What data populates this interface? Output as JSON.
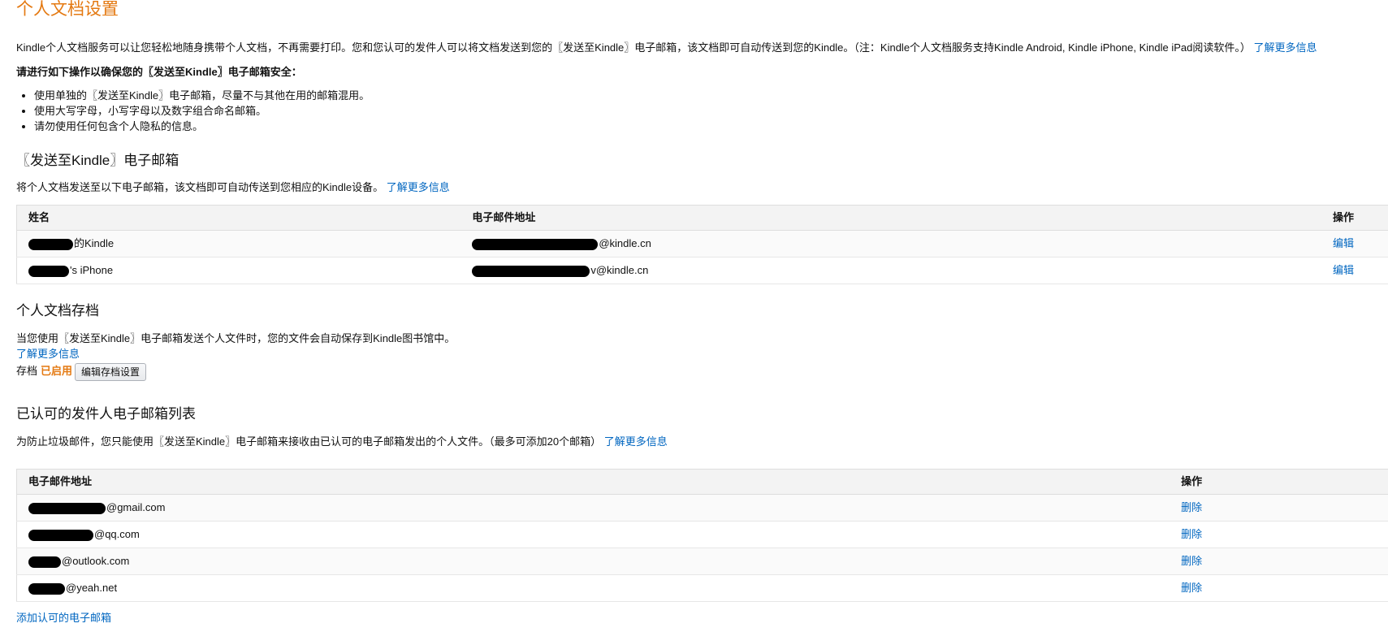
{
  "page": {
    "title": "个人文档设置",
    "intro_text": "Kindle个人文档服务可以让您轻松地随身携带个人文档，不再需要打印。您和您认可的发件人可以将文档发送到您的〖发送至Kindle〗电子邮箱，该文档即可自动传送到您的Kindle。（注：Kindle个人文档服务支持Kindle Android, Kindle iPhone, Kindle iPad阅读软件。）",
    "learn_more": "了解更多信息",
    "security_heading": "请进行如下操作以确保您的〖发送至Kindle〗电子邮箱安全：",
    "tips": [
      "使用单独的〖发送至Kindle〗电子邮箱，尽量不与其他在用的邮箱混用。",
      "使用大写字母，小写字母以及数字组合命名邮箱。",
      "请勿使用任何包含个人隐私的信息。"
    ]
  },
  "send_to_kindle": {
    "title": "〖发送至Kindle〗电子邮箱",
    "desc": "将个人文档发送至以下电子邮箱，该文档即可自动传送到您相应的Kindle设备。",
    "learn_more": "了解更多信息",
    "columns": {
      "name": "姓名",
      "email": "电子邮件地址",
      "action": "操作"
    },
    "rows": [
      {
        "name_suffix": "的Kindle",
        "email_suffix": "@kindle.cn",
        "action": "编辑"
      },
      {
        "name_suffix": "'s iPhone",
        "email_suffix": "v@kindle.cn",
        "action": "编辑"
      }
    ]
  },
  "archive": {
    "title": "个人文档存档",
    "desc": "当您使用〖发送至Kindle〗电子邮箱发送个人文件时，您的文件会自动保存到Kindle图书馆中。",
    "learn_more": "了解更多信息",
    "label": "存档",
    "status": "已启用",
    "edit_button": "编辑存档设置"
  },
  "approved_senders": {
    "title": "已认可的发件人电子邮箱列表",
    "desc": "为防止垃圾邮件，您只能使用〖发送至Kindle〗电子邮箱来接收由已认可的电子邮箱发出的个人文件。（最多可添加20个邮箱）",
    "learn_more": "了解更多信息",
    "columns": {
      "email": "电子邮件地址",
      "action": "操作"
    },
    "rows": [
      {
        "email_suffix": "@gmail.com",
        "action": "删除"
      },
      {
        "email_suffix": "@qq.com",
        "action": "删除"
      },
      {
        "email_suffix": "@outlook.com",
        "action": "删除"
      },
      {
        "email_suffix": "@yeah.net",
        "action": "删除"
      }
    ],
    "add_link": "添加认可的电子邮箱"
  },
  "colors": {
    "accent": "#e47911",
    "link": "#0066c0"
  }
}
